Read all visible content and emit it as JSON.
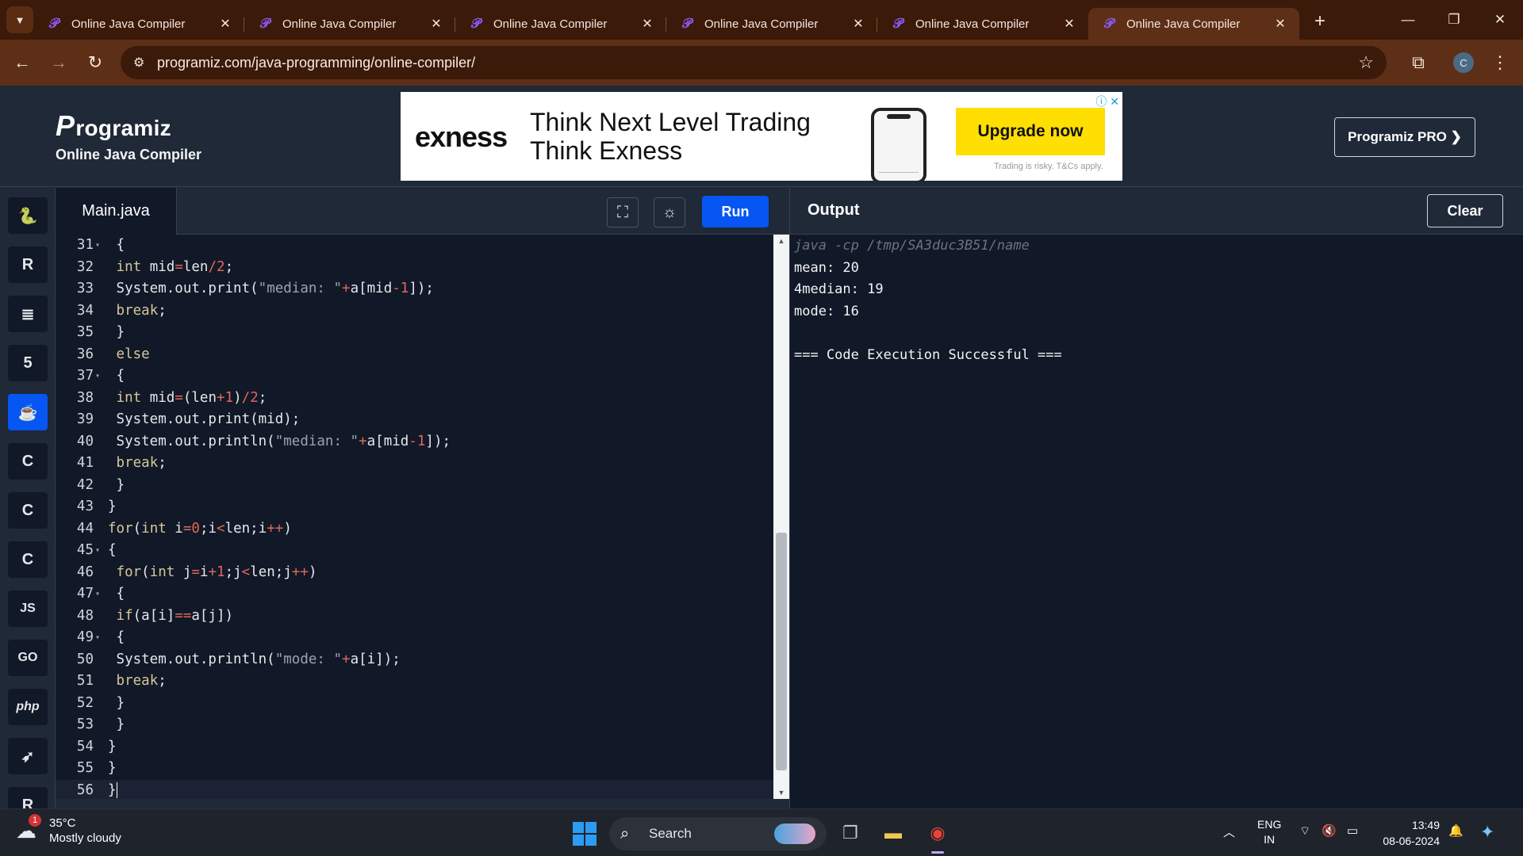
{
  "browser": {
    "tabs": [
      {
        "title": "Online Java Compiler",
        "active": false
      },
      {
        "title": "Online Java Compiler",
        "active": false
      },
      {
        "title": "Online Java Compiler",
        "active": false
      },
      {
        "title": "Online Java Compiler",
        "active": false
      },
      {
        "title": "Online Java Compiler",
        "active": false
      },
      {
        "title": "Online Java Compiler",
        "active": true
      }
    ],
    "url": "programiz.com/java-programming/online-compiler/",
    "profile_initial": "C"
  },
  "site": {
    "logo": "rogramiz",
    "logo_initial": "P",
    "subtitle": "Online Java Compiler",
    "pro_button": "Programiz PRO ❯",
    "ad": {
      "brand": "exness",
      "headline_1": "Think Next Level Trading",
      "headline_2": "Think Exness",
      "cta": "Upgrade now",
      "disclaimer": "Trading is risky. T&Cs apply."
    }
  },
  "rail": {
    "languages": [
      {
        "name": "python",
        "label": "🐍",
        "active": false
      },
      {
        "name": "r",
        "label": "R",
        "active": false
      },
      {
        "name": "sql",
        "label": "≣",
        "active": false
      },
      {
        "name": "html",
        "label": "5",
        "active": false
      },
      {
        "name": "java",
        "label": "☕",
        "active": true
      },
      {
        "name": "c",
        "label": "C",
        "active": false
      },
      {
        "name": "cpp",
        "label": "C",
        "active": false
      },
      {
        "name": "csharp",
        "label": "C",
        "active": false
      },
      {
        "name": "javascript",
        "label": "JS",
        "active": false
      },
      {
        "name": "go",
        "label": "GO",
        "active": false
      },
      {
        "name": "php",
        "label": "php",
        "active": false
      },
      {
        "name": "swift",
        "label": "➶",
        "active": false
      },
      {
        "name": "rust",
        "label": "R",
        "active": false
      }
    ]
  },
  "editor": {
    "file_name": "Main.java",
    "run_label": "Run",
    "lines": [
      {
        "n": "31",
        "fold": true,
        "html": " {"
      },
      {
        "n": "32",
        "fold": false,
        "html": " <span class=\"kw\">int</span> mid<span class=\"op\">=</span>len<span class=\"op\">/</span><span class=\"num\">2</span>;"
      },
      {
        "n": "33",
        "fold": false,
        "html": " System.out.print(<span class=\"str\">\"median: \"</span><span class=\"op\">+</span>a[mid<span class=\"op\">-</span><span class=\"num\">1</span>]);"
      },
      {
        "n": "34",
        "fold": false,
        "html": " <span class=\"kw\">break</span>;"
      },
      {
        "n": "35",
        "fold": false,
        "html": " }"
      },
      {
        "n": "36",
        "fold": false,
        "html": " <span class=\"kw\">else</span>"
      },
      {
        "n": "37",
        "fold": true,
        "html": " {"
      },
      {
        "n": "38",
        "fold": false,
        "html": " <span class=\"kw\">int</span> mid<span class=\"op\">=</span>(len<span class=\"op\">+</span><span class=\"num\">1</span>)<span class=\"op\">/</span><span class=\"num\">2</span>;"
      },
      {
        "n": "39",
        "fold": false,
        "html": " System.out.print(mid);"
      },
      {
        "n": "40",
        "fold": false,
        "html": " System.out.println(<span class=\"str\">\"median: \"</span><span class=\"op\">+</span>a[mid<span class=\"op\">-</span><span class=\"num\">1</span>]);"
      },
      {
        "n": "41",
        "fold": false,
        "html": " <span class=\"kw\">break</span>;"
      },
      {
        "n": "42",
        "fold": false,
        "html": " }"
      },
      {
        "n": "43",
        "fold": false,
        "html": "}"
      },
      {
        "n": "44",
        "fold": false,
        "html": "<span class=\"kw\">for</span>(<span class=\"kw\">int</span> i<span class=\"op\">=</span><span class=\"num\">0</span>;i<span class=\"op\">&lt;</span>len;i<span class=\"op\">++</span>)"
      },
      {
        "n": "45",
        "fold": true,
        "html": "{"
      },
      {
        "n": "46",
        "fold": false,
        "html": " <span class=\"kw\">for</span>(<span class=\"kw\">int</span> j<span class=\"op\">=</span>i<span class=\"op\">+</span><span class=\"num\">1</span>;j<span class=\"op\">&lt;</span>len;j<span class=\"op\">++</span>)"
      },
      {
        "n": "47",
        "fold": true,
        "html": " {"
      },
      {
        "n": "48",
        "fold": false,
        "html": " <span class=\"kw\">if</span>(a[i]<span class=\"op\">==</span>a[j])"
      },
      {
        "n": "49",
        "fold": true,
        "html": " {"
      },
      {
        "n": "50",
        "fold": false,
        "html": " System.out.println(<span class=\"str\">\"mode: \"</span><span class=\"op\">+</span>a[i]);"
      },
      {
        "n": "51",
        "fold": false,
        "html": " <span class=\"kw\">break</span>;"
      },
      {
        "n": "52",
        "fold": false,
        "html": " }"
      },
      {
        "n": "53",
        "fold": false,
        "html": " }"
      },
      {
        "n": "54",
        "fold": false,
        "html": "}"
      },
      {
        "n": "55",
        "fold": false,
        "html": "}"
      },
      {
        "n": "56",
        "fold": false,
        "html": "}",
        "current": true
      }
    ]
  },
  "output": {
    "title": "Output",
    "clear_label": "Clear",
    "lines": [
      {
        "text": "java -cp /tmp/SA3duc3B51/name",
        "type": "cmd"
      },
      {
        "text": "mean: 20",
        "type": "out"
      },
      {
        "text": "4median: 19",
        "type": "out"
      },
      {
        "text": "mode: 16",
        "type": "out"
      },
      {
        "text": "",
        "type": "out"
      },
      {
        "text": "=== Code Execution Successful ===",
        "type": "out"
      }
    ]
  },
  "taskbar": {
    "weather_temp": "35°C",
    "weather_desc": "Mostly cloudy",
    "weather_badge": "1",
    "search_placeholder": "Search",
    "lang_1": "ENG",
    "lang_2": "IN",
    "time": "13:49",
    "date": "08-06-2024"
  }
}
